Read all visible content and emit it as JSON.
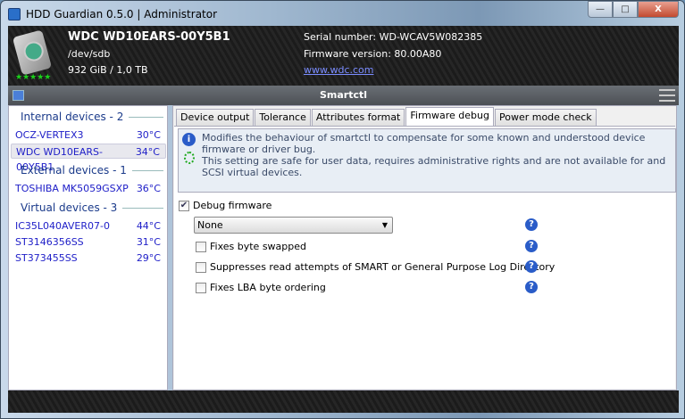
{
  "window": {
    "title": "HDD Guardian 0.5.0 | Administrator",
    "min": "—",
    "max": "□",
    "close": "X"
  },
  "header": {
    "model": "WDC WD10EARS-00Y5B1",
    "device": "/dev/sdb",
    "size": "932 GiB / 1,0 TB",
    "stars": "★★★★★",
    "serial": "Serial number: WD-WCAV5W082385",
    "firmware": "Firmware version: 80.00A80",
    "link": "www.wdc.com"
  },
  "toolbar": {
    "title": "Smartctl"
  },
  "sidebar": {
    "groups": [
      "Internal devices - 2",
      "External devices - 1",
      "Virtual devices - 3"
    ],
    "devices": [
      {
        "name": "OCZ-VERTEX3",
        "temp": "30°C"
      },
      {
        "name": "WDC WD10EARS-00Y5B1",
        "temp": "34°C"
      },
      {
        "name": "TOSHIBA MK5059GSXP",
        "temp": "36°C"
      },
      {
        "name": "IC35L040AVER07-0",
        "temp": "44°C"
      },
      {
        "name": "ST3146356SS",
        "temp": "31°C"
      },
      {
        "name": "ST373455SS",
        "temp": "29°C"
      }
    ]
  },
  "tabs": [
    "Device output",
    "Tolerance",
    "Attributes format",
    "Firmware debug",
    "Power mode check"
  ],
  "firmware_debug": {
    "info": "Modifies the behaviour of smartctl to compensate for some known and understood device firmware or driver bug.\nThis setting are safe for user data, requires administrative rights and are not available for and SCSI virtual devices.",
    "debug_label": "Debug firmware",
    "debug_checked": true,
    "select_value": "None",
    "options": [
      {
        "label": "Fixes byte swapped",
        "checked": false
      },
      {
        "label": "Suppresses read attempts of SMART or General Purpose Log Directory",
        "checked": false
      },
      {
        "label": "Fixes LBA byte ordering",
        "checked": false
      }
    ],
    "help": "?"
  }
}
